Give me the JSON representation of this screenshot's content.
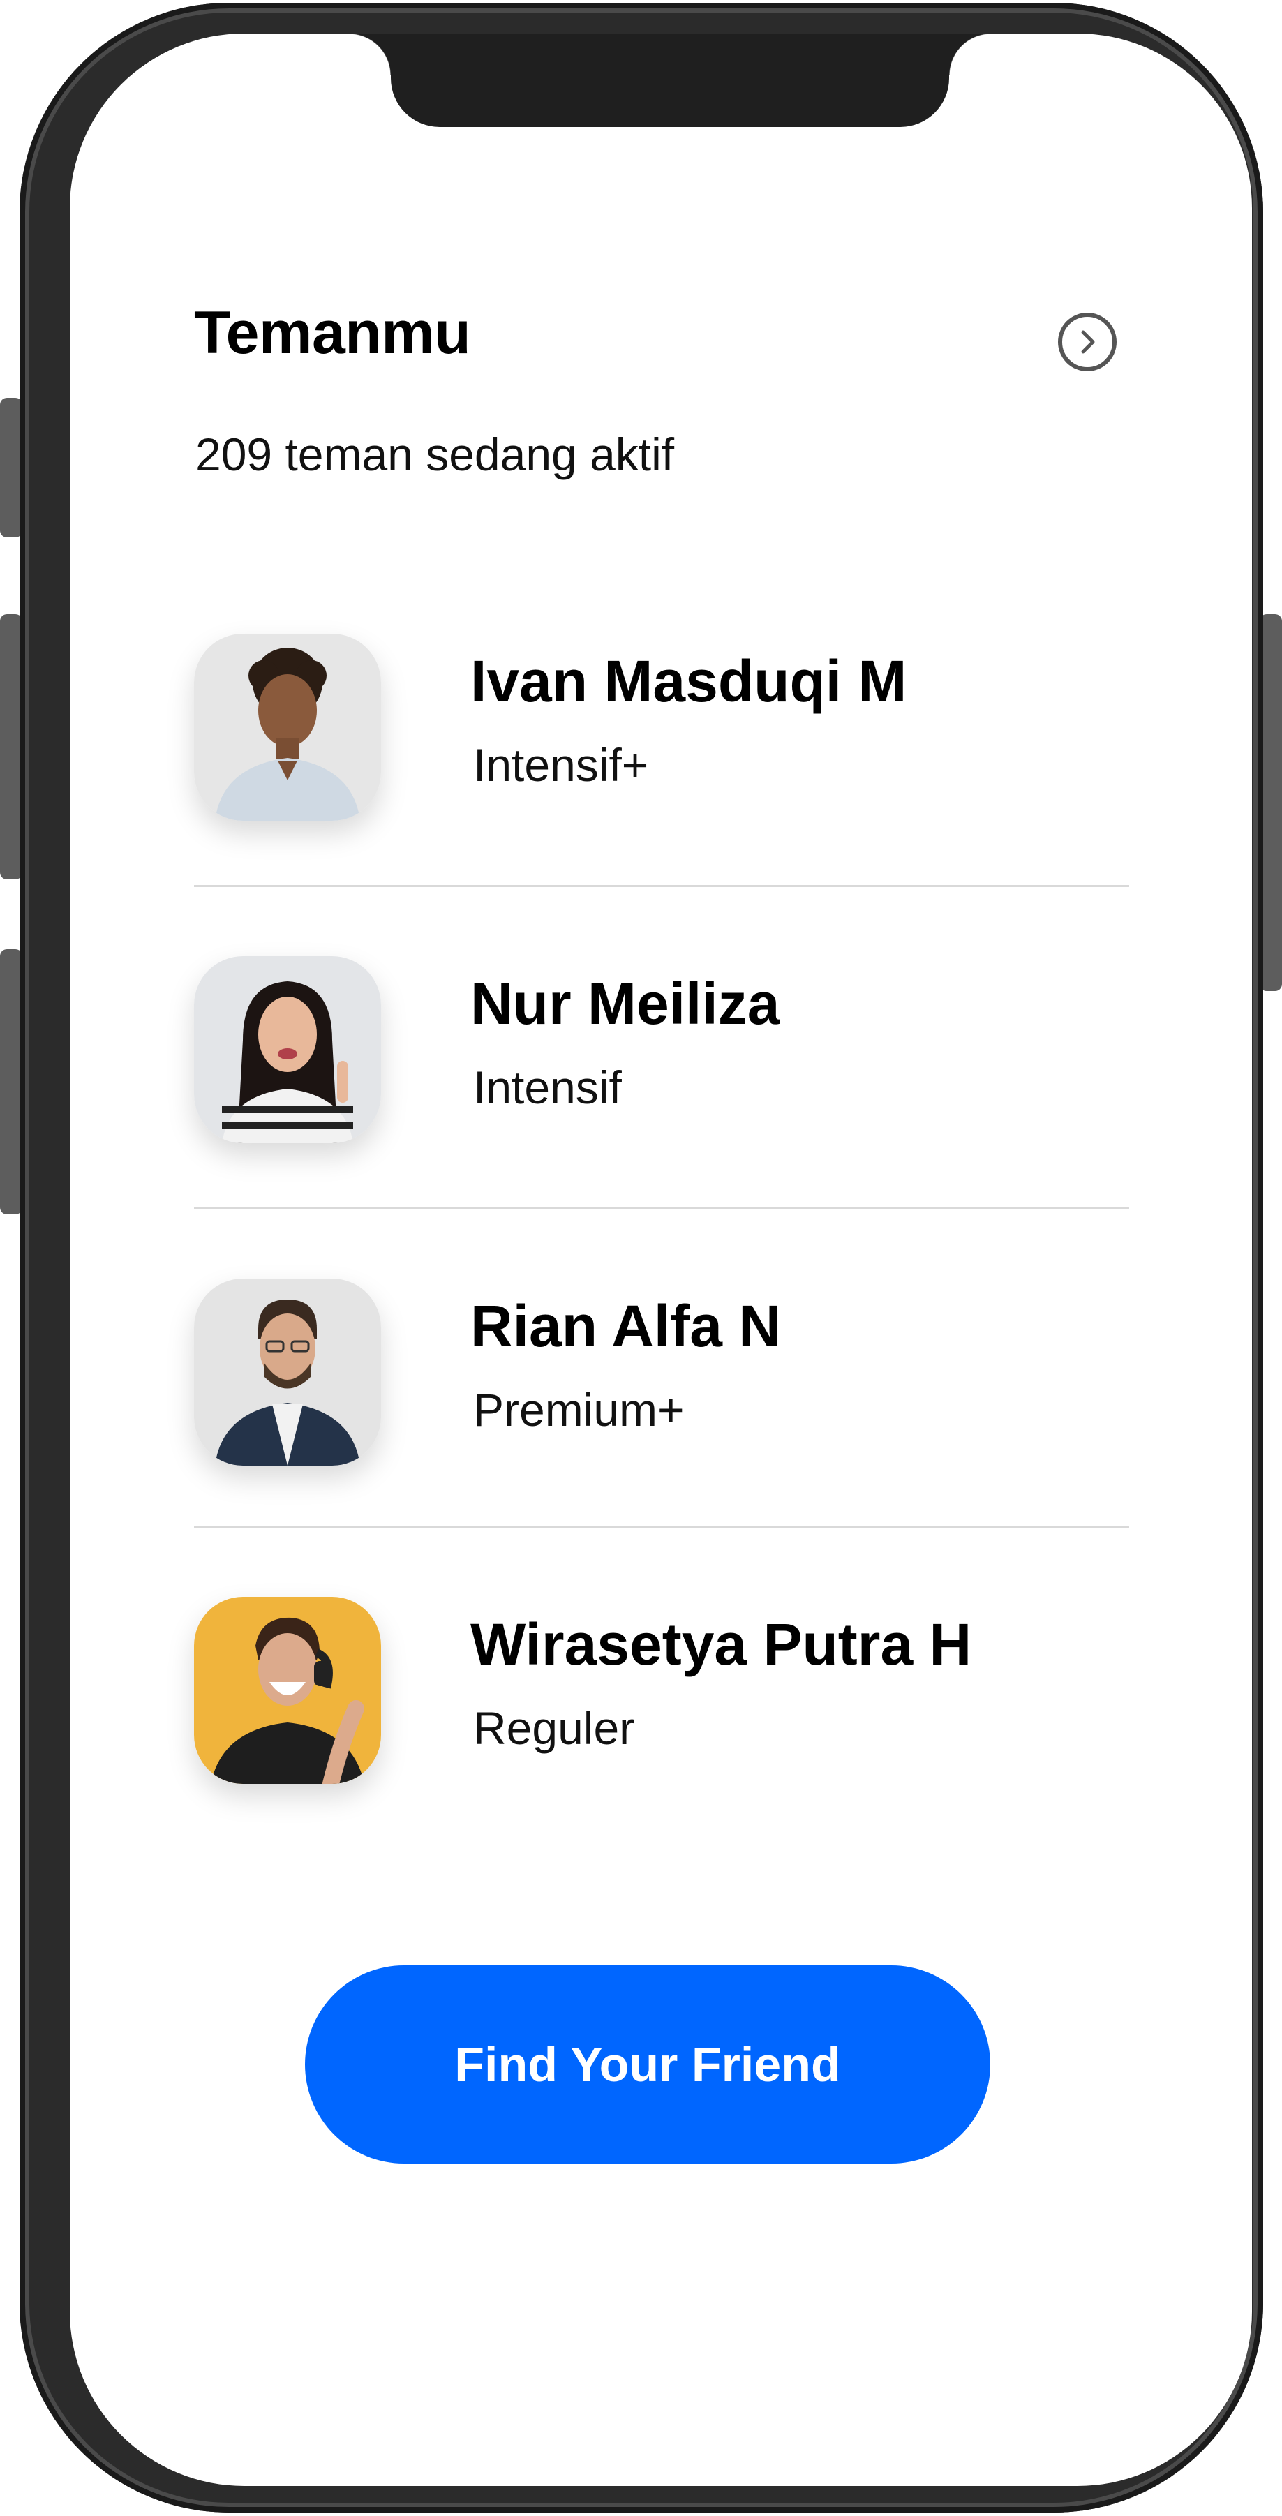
{
  "header": {
    "title": "Temanmu",
    "subtitle": "209 teman sedang aktif",
    "next_icon": "chevron-right-circle-icon"
  },
  "friends": [
    {
      "name": "Ivan Masduqi M",
      "plan": "Intensif+",
      "avatar_bg": "#e6e6e6"
    },
    {
      "name": "Nur Meiliza",
      "plan": "Intensif",
      "avatar_bg": "#e3e5e8"
    },
    {
      "name": "Rian Alfa N",
      "plan": "Premium+",
      "avatar_bg": "#e4e4e4"
    },
    {
      "name": "Wirasetya Putra H",
      "plan": "Reguler",
      "avatar_bg": "#f0b43c"
    }
  ],
  "cta": {
    "label": "Find Your Friend",
    "color": "#0066ff"
  },
  "colors": {
    "frame": "#2b2b2b",
    "notch": "#1f1f1f",
    "divider": "#d9d9d9"
  }
}
